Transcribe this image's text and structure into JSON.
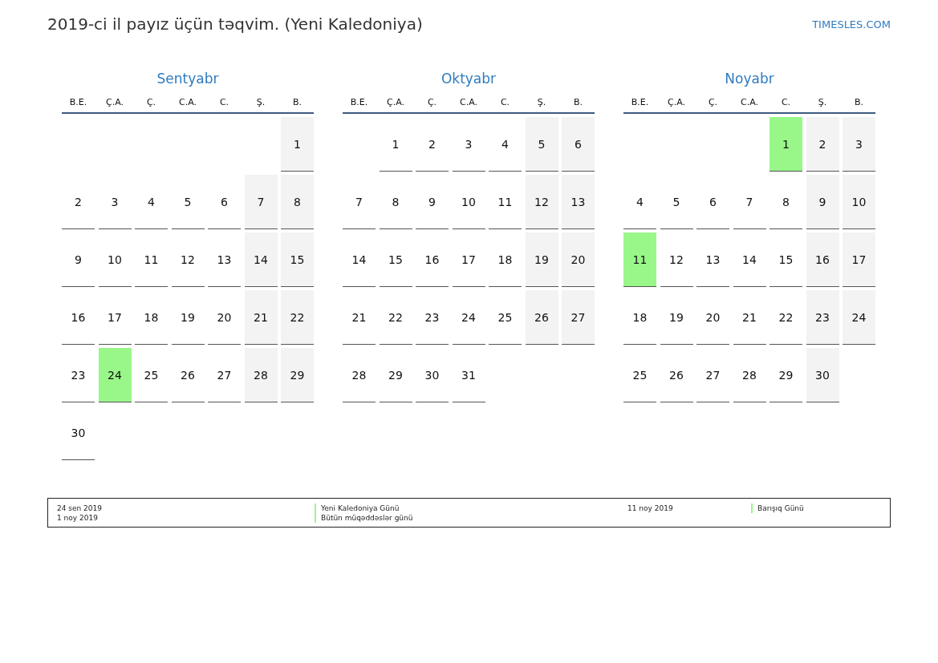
{
  "title": "2019-ci il payız üçün təqvim. (Yeni Kaledoniya)",
  "site_link": "TIMESLES.COM",
  "months": [
    {
      "name": "Sentyabr",
      "weekdays": [
        "B.E.",
        "Ç.A.",
        "Ç.",
        "C.A.",
        "C.",
        "Ş.",
        "B."
      ],
      "weeks": [
        [
          {
            "day": "1",
            "kind": "weekend"
          }
        ],
        [
          {
            "day": "2",
            "kind": "workday"
          },
          {
            "day": "3",
            "kind": "workday"
          },
          {
            "day": "4",
            "kind": "workday"
          },
          {
            "day": "5",
            "kind": "workday"
          },
          {
            "day": "6",
            "kind": "workday"
          },
          {
            "day": "7",
            "kind": "weekend"
          },
          {
            "day": "8",
            "kind": "weekend"
          }
        ],
        [
          {
            "day": "9",
            "kind": "workday"
          },
          {
            "day": "10",
            "kind": "workday"
          },
          {
            "day": "11",
            "kind": "workday"
          },
          {
            "day": "12",
            "kind": "workday"
          },
          {
            "day": "13",
            "kind": "workday"
          },
          {
            "day": "14",
            "kind": "weekend"
          },
          {
            "day": "15",
            "kind": "weekend"
          }
        ],
        [
          {
            "day": "16",
            "kind": "workday"
          },
          {
            "day": "17",
            "kind": "workday"
          },
          {
            "day": "18",
            "kind": "workday"
          },
          {
            "day": "19",
            "kind": "workday"
          },
          {
            "day": "20",
            "kind": "workday"
          },
          {
            "day": "21",
            "kind": "weekend"
          },
          {
            "day": "22",
            "kind": "weekend"
          }
        ],
        [
          {
            "day": "23",
            "kind": "workday"
          },
          {
            "day": "24",
            "kind": "holiday"
          },
          {
            "day": "25",
            "kind": "workday"
          },
          {
            "day": "26",
            "kind": "workday"
          },
          {
            "day": "27",
            "kind": "workday"
          },
          {
            "day": "28",
            "kind": "weekend"
          },
          {
            "day": "29",
            "kind": "weekend"
          }
        ],
        [
          {
            "day": "30",
            "kind": "workday"
          }
        ]
      ]
    },
    {
      "name": "Oktyabr",
      "weekdays": [
        "B.E.",
        "Ç.A.",
        "Ç.",
        "C.A.",
        "C.",
        "Ş.",
        "B."
      ],
      "weeks": [
        [
          {
            "day": "1",
            "kind": "workday"
          },
          {
            "day": "2",
            "kind": "workday"
          },
          {
            "day": "3",
            "kind": "workday"
          },
          {
            "day": "4",
            "kind": "workday"
          },
          {
            "day": "5",
            "kind": "weekend"
          },
          {
            "day": "6",
            "kind": "weekend"
          }
        ],
        [
          {
            "day": "7",
            "kind": "workday"
          },
          {
            "day": "8",
            "kind": "workday"
          },
          {
            "day": "9",
            "kind": "workday"
          },
          {
            "day": "10",
            "kind": "workday"
          },
          {
            "day": "11",
            "kind": "workday"
          },
          {
            "day": "12",
            "kind": "weekend"
          },
          {
            "day": "13",
            "kind": "weekend"
          }
        ],
        [
          {
            "day": "14",
            "kind": "workday"
          },
          {
            "day": "15",
            "kind": "workday"
          },
          {
            "day": "16",
            "kind": "workday"
          },
          {
            "day": "17",
            "kind": "workday"
          },
          {
            "day": "18",
            "kind": "workday"
          },
          {
            "day": "19",
            "kind": "weekend"
          },
          {
            "day": "20",
            "kind": "weekend"
          }
        ],
        [
          {
            "day": "21",
            "kind": "workday"
          },
          {
            "day": "22",
            "kind": "workday"
          },
          {
            "day": "23",
            "kind": "workday"
          },
          {
            "day": "24",
            "kind": "workday"
          },
          {
            "day": "25",
            "kind": "workday"
          },
          {
            "day": "26",
            "kind": "weekend"
          },
          {
            "day": "27",
            "kind": "weekend"
          }
        ],
        [
          {
            "day": "28",
            "kind": "workday"
          },
          {
            "day": "29",
            "kind": "workday"
          },
          {
            "day": "30",
            "kind": "workday"
          },
          {
            "day": "31",
            "kind": "workday"
          }
        ]
      ]
    },
    {
      "name": "Noyabr",
      "weekdays": [
        "B.E.",
        "Ç.A.",
        "Ç.",
        "C.A.",
        "C.",
        "Ş.",
        "B."
      ],
      "weeks": [
        [
          {
            "day": "1",
            "kind": "holiday"
          },
          {
            "day": "2",
            "kind": "weekend"
          },
          {
            "day": "3",
            "kind": "weekend"
          }
        ],
        [
          {
            "day": "4",
            "kind": "workday"
          },
          {
            "day": "5",
            "kind": "workday"
          },
          {
            "day": "6",
            "kind": "workday"
          },
          {
            "day": "7",
            "kind": "workday"
          },
          {
            "day": "8",
            "kind": "workday"
          },
          {
            "day": "9",
            "kind": "weekend"
          },
          {
            "day": "10",
            "kind": "weekend"
          }
        ],
        [
          {
            "day": "11",
            "kind": "holiday"
          },
          {
            "day": "12",
            "kind": "workday"
          },
          {
            "day": "13",
            "kind": "workday"
          },
          {
            "day": "14",
            "kind": "workday"
          },
          {
            "day": "15",
            "kind": "workday"
          },
          {
            "day": "16",
            "kind": "weekend"
          },
          {
            "day": "17",
            "kind": "weekend"
          }
        ],
        [
          {
            "day": "18",
            "kind": "workday"
          },
          {
            "day": "19",
            "kind": "workday"
          },
          {
            "day": "20",
            "kind": "workday"
          },
          {
            "day": "21",
            "kind": "workday"
          },
          {
            "day": "22",
            "kind": "workday"
          },
          {
            "day": "23",
            "kind": "weekend"
          },
          {
            "day": "24",
            "kind": "weekend"
          }
        ],
        [
          {
            "day": "25",
            "kind": "workday"
          },
          {
            "day": "26",
            "kind": "workday"
          },
          {
            "day": "27",
            "kind": "workday"
          },
          {
            "day": "28",
            "kind": "workday"
          },
          {
            "day": "29",
            "kind": "workday"
          },
          {
            "day": "30",
            "kind": "weekend"
          }
        ]
      ]
    }
  ],
  "legend": [
    {
      "entries": [
        {
          "date": "24 sen 2019",
          "name": "Yeni Kaledoniya Günü"
        },
        {
          "date": "1 noy 2019",
          "name": "Bütün müqəddəslər günü"
        }
      ]
    },
    {
      "entries": [
        {
          "date": "11 noy 2019",
          "name": "Barışıq Günü"
        }
      ]
    }
  ]
}
